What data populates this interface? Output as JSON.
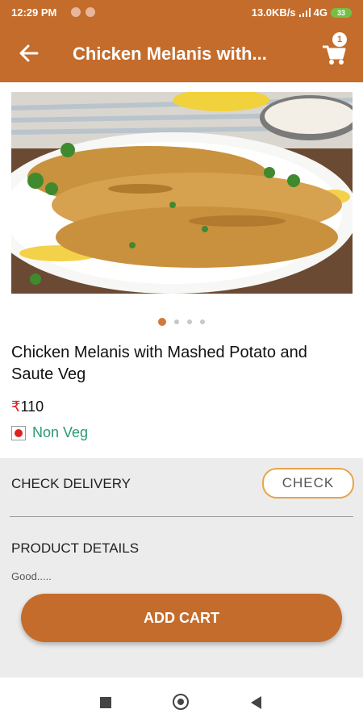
{
  "status_bar": {
    "time": "12:29 PM",
    "network": "13.0KB/s",
    "signal": "4G",
    "battery": "33"
  },
  "app_bar": {
    "title": "Chicken Melanis with...",
    "cart_count": "1"
  },
  "product": {
    "name": "Chicken Melanis with Mashed Potato and Saute Veg",
    "currency": "₹",
    "price": "110",
    "type": "Non Veg",
    "image_count": 4,
    "active_image": 0
  },
  "delivery": {
    "label": "CHECK DELIVERY",
    "button": "CHECK"
  },
  "details": {
    "label": "PRODUCT DETAILS",
    "text": "Good....."
  },
  "actions": {
    "add_cart": "ADD CART"
  },
  "colors": {
    "primary": "#c46c2c",
    "check_border": "#e8a44a",
    "non_veg": "#2a9a73",
    "badge_red": "#dd2222"
  },
  "icons": {
    "back": "arrow-left-icon",
    "cart": "shopping-cart-icon",
    "nav_recents": "square-icon",
    "nav_home": "circle-icon",
    "nav_back": "triangle-back-icon"
  }
}
